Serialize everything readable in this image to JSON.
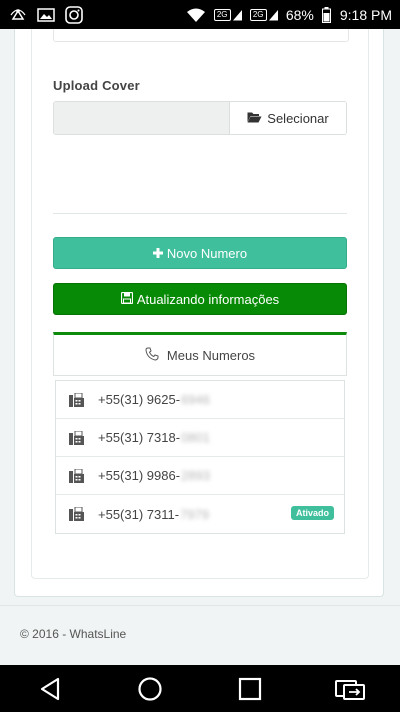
{
  "status_bar": {
    "battery_percent": "68%",
    "time": "9:18 PM",
    "signal_badge": "2G",
    "left_icons": [
      "wifi-hotspot-icon",
      "image-icon",
      "instagram-icon"
    ],
    "right_icons": [
      "wifi-icon",
      "signal-icon",
      "signal-icon",
      "battery-icon"
    ]
  },
  "form": {
    "upload_cover_label": "Upload Cover",
    "select_button_label": "Selecionar",
    "novo_numero_label": "Novo Numero",
    "atualizando_label": "Atualizando informações"
  },
  "numbers": {
    "header": "Meus Numeros",
    "items": [
      {
        "prefix": "+55(31) 9625-",
        "hidden": "6946"
      },
      {
        "prefix": "+55(31) 7318-",
        "hidden": "0801"
      },
      {
        "prefix": "+55(31) 9986-",
        "hidden": "2893"
      },
      {
        "prefix": "+55(31) 7311-",
        "hidden": "7979",
        "badge": "Ativado"
      }
    ]
  },
  "footer": {
    "text": "© 2016 - WhatsLine"
  },
  "colors": {
    "teal_button": "#3fbf9c",
    "green_button": "#078a05",
    "card_accent": "#0e8a0b"
  },
  "nav_bar": {
    "icons": [
      "back-icon",
      "home-icon",
      "recents-icon",
      "screen-mirror-icon"
    ]
  }
}
